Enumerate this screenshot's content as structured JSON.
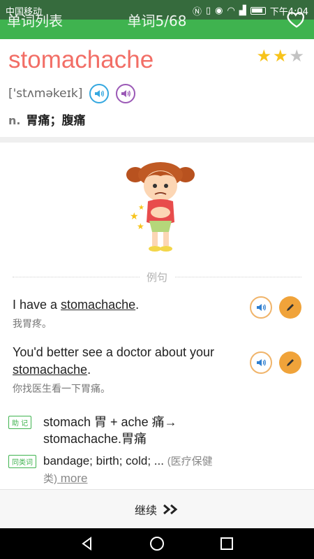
{
  "status_bar": {
    "carrier": "中国移动",
    "time": "下午4:04",
    "icons": [
      "nfc-icon",
      "vibrate-icon",
      "eye-icon",
      "wifi-icon",
      "signal-icon",
      "battery-icon"
    ]
  },
  "header": {
    "list_label": "单词列表",
    "progress": "单词5/68",
    "favorite_icon": "heart-outline-icon"
  },
  "word": {
    "text": "stomachache",
    "phonetic": "['stʌməkeɪk]",
    "stars": {
      "filled": 2,
      "total": 3
    },
    "pos": "n.",
    "meaning": "胃痛；腹痛",
    "audio_icons": [
      "speaker-blue-icon",
      "speaker-purple-icon"
    ]
  },
  "examples_label": "例句",
  "examples": [
    {
      "en_before": "I have a ",
      "en_word": "stomachache",
      "en_after": ".",
      "zh": "我胃疼。"
    },
    {
      "en_before": "You'd better see a doctor about your ",
      "en_word": "stomachache",
      "en_after": ".",
      "zh": "你找医生看一下胃痛。"
    }
  ],
  "memory": {
    "tag": "助 记",
    "text": "stomach 胃 + ache 痛→ stomachache.胃痛"
  },
  "similar": {
    "tag": "同类词",
    "words": "bandage; birth; cold; ...",
    "note_a": "(医疗保健",
    "note_b": "类)",
    "more": " more "
  },
  "continue": {
    "label": "继续"
  },
  "colors": {
    "green": "#3fb34f",
    "word": "#f26e66",
    "star": "#f7c31b",
    "pencil": "#f0a33a"
  }
}
